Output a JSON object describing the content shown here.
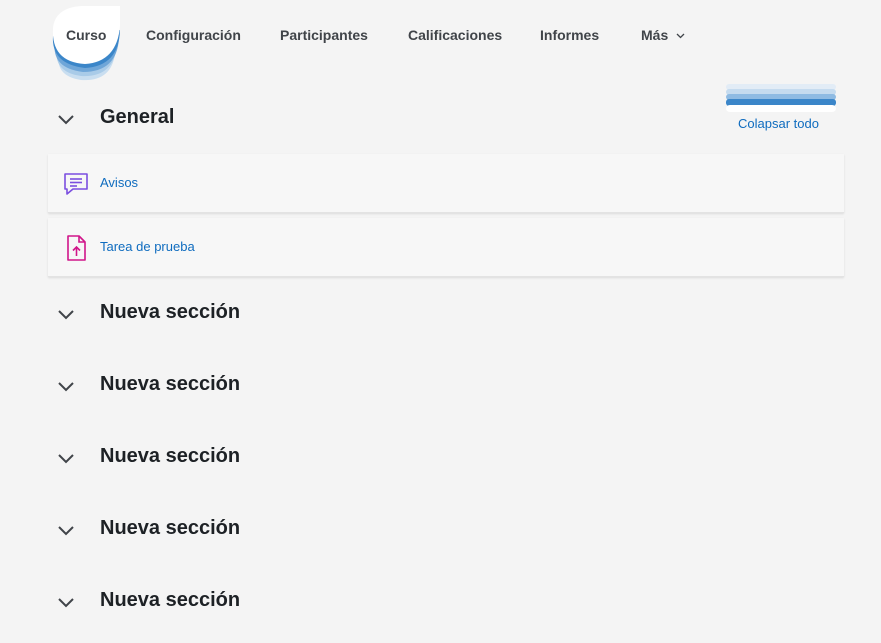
{
  "nav": {
    "tabs": [
      {
        "label": "Curso",
        "active": true
      },
      {
        "label": "Configuración"
      },
      {
        "label": "Participantes"
      },
      {
        "label": "Calificaciones"
      },
      {
        "label": "Informes"
      },
      {
        "label": "Más"
      }
    ]
  },
  "collapse_all_label": "Colapsar todo",
  "sections": [
    {
      "title": "General"
    },
    {
      "title": "Nueva sección"
    },
    {
      "title": "Nueva sección"
    },
    {
      "title": "Nueva sección"
    },
    {
      "title": "Nueva sección"
    },
    {
      "title": "Nueva sección"
    }
  ],
  "activities": [
    {
      "name": "Avisos",
      "icon": "forum-icon",
      "icon_color": "#7b4fe0"
    },
    {
      "name": "Tarea de prueba",
      "icon": "assignment-upload-icon",
      "icon_color": "#d1168a"
    }
  ],
  "colors": {
    "accent": "#0f6cbf",
    "blob": "#3b86c9"
  }
}
